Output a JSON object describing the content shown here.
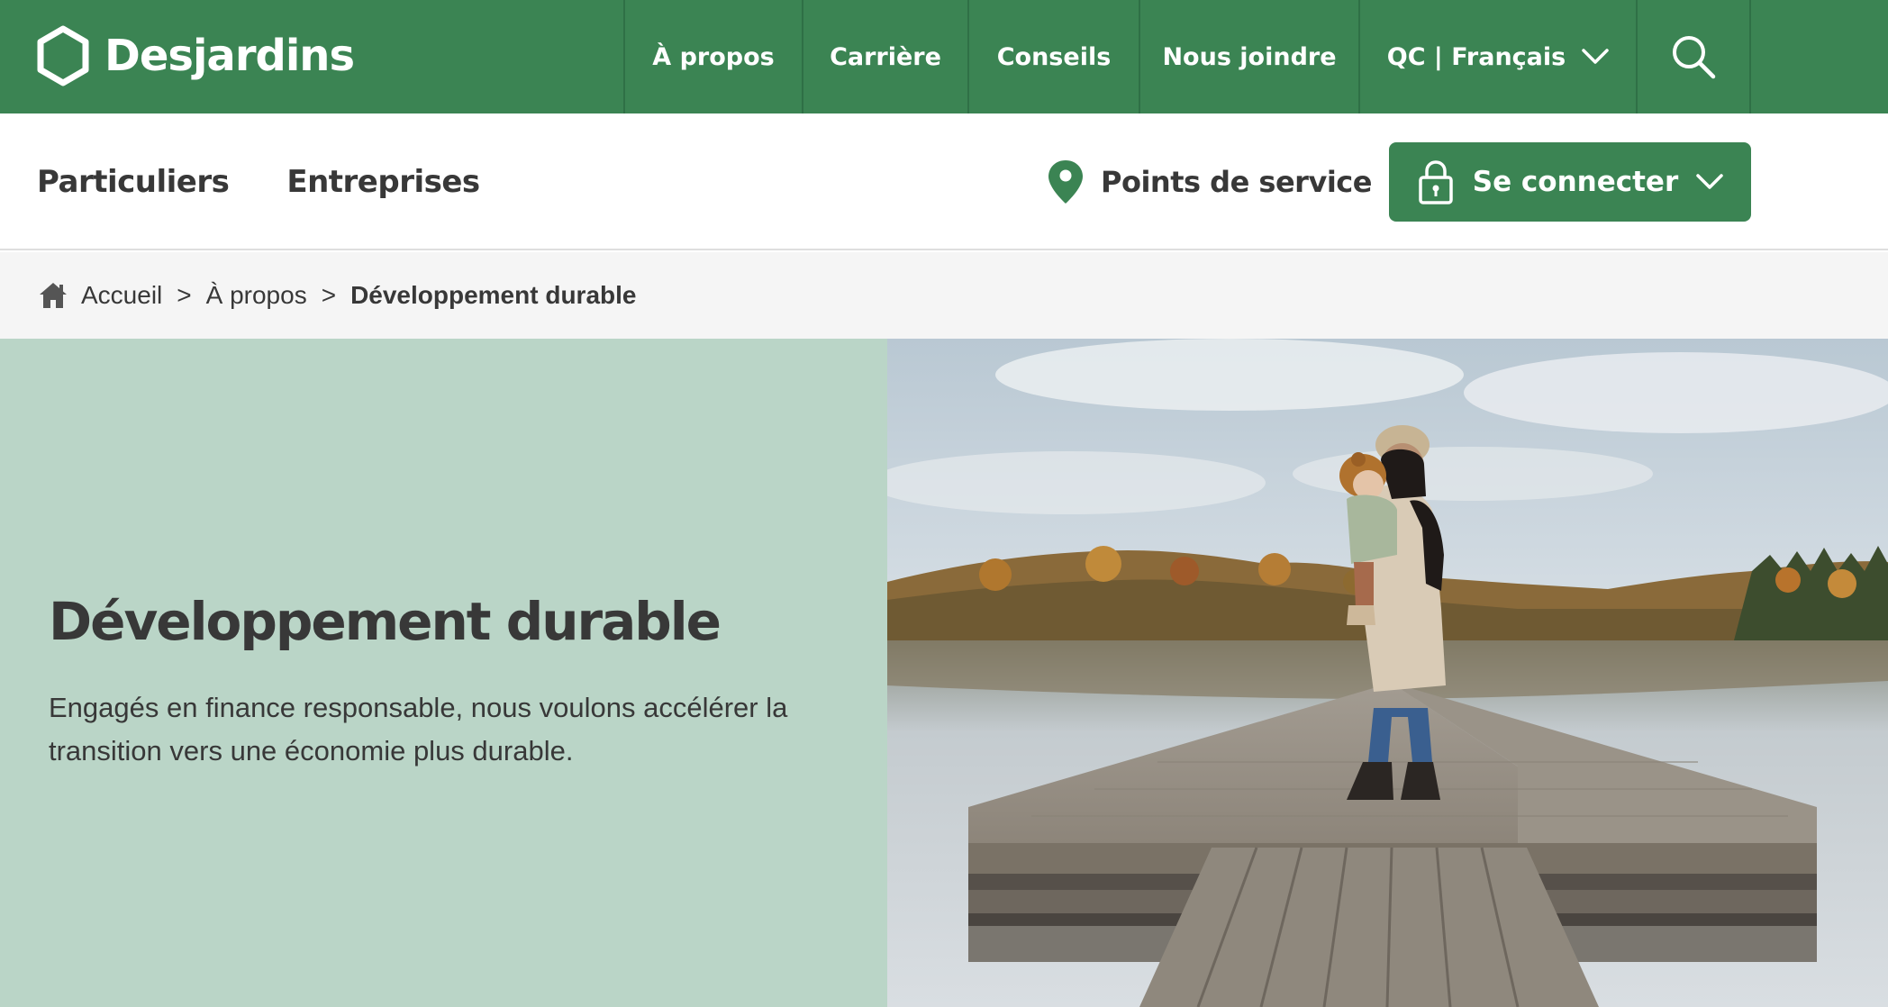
{
  "brand": {
    "name": "Desjardins",
    "color": "#3b8453"
  },
  "topnav": {
    "items": [
      {
        "label": "À propos"
      },
      {
        "label": "Carrière"
      },
      {
        "label": "Conseils"
      },
      {
        "label": "Nous joindre"
      }
    ],
    "language": "QC | Français",
    "search_icon": "search-icon"
  },
  "secondary_nav": {
    "particuliers": "Particuliers",
    "entreprises": "Entreprises",
    "points_de_service": "Points de service",
    "login_label": "Se connecter"
  },
  "breadcrumb": {
    "home_icon": "home-icon",
    "items": [
      "Accueil",
      "À propos"
    ],
    "current": "Développement durable",
    "separator": ">"
  },
  "hero": {
    "title": "Développement durable",
    "text": "Engagés en finance responsable, nous voulons accélérer la transition vers une économie plus durable."
  },
  "colors": {
    "primary_green": "#3b8453",
    "hero_panel": "#bad5c7",
    "text": "#383838",
    "breadcrumb_bg": "#f5f5f5"
  }
}
